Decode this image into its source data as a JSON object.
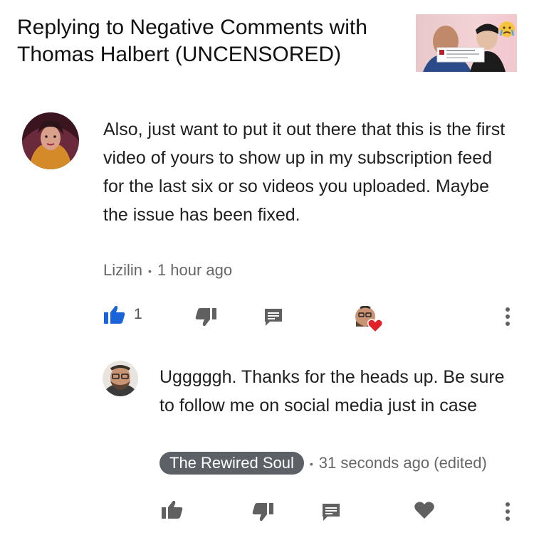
{
  "video": {
    "title": "Replying to Negative Comments with Thomas Halbert (UNCENSORED)"
  },
  "comment": {
    "text": "Also, just want to put it out there that this is the first video of yours to show up in my subscription feed for the last six or so videos you uploaded. Maybe the issue has been fixed.",
    "author": "Lizilin",
    "separator": "•",
    "time": "1 hour ago",
    "like_count": "1",
    "liked": true,
    "hearted_by_creator": true
  },
  "reply": {
    "text": "Ugggggh. Thanks for the heads up. Be sure to follow me on social media just in case",
    "author": "The Rewired Soul",
    "separator": "•",
    "time": "31 seconds ago (edited)"
  },
  "icons": {
    "like": "thumbs-up-icon",
    "dislike": "thumbs-down-icon",
    "reply": "comment-icon",
    "more": "more-vert-icon",
    "heart": "heart-icon"
  },
  "colors": {
    "liked_blue": "#1a63d8",
    "icon_gray": "#606060",
    "heart_red": "#e1222b",
    "badge_bg": "#5b6167"
  }
}
